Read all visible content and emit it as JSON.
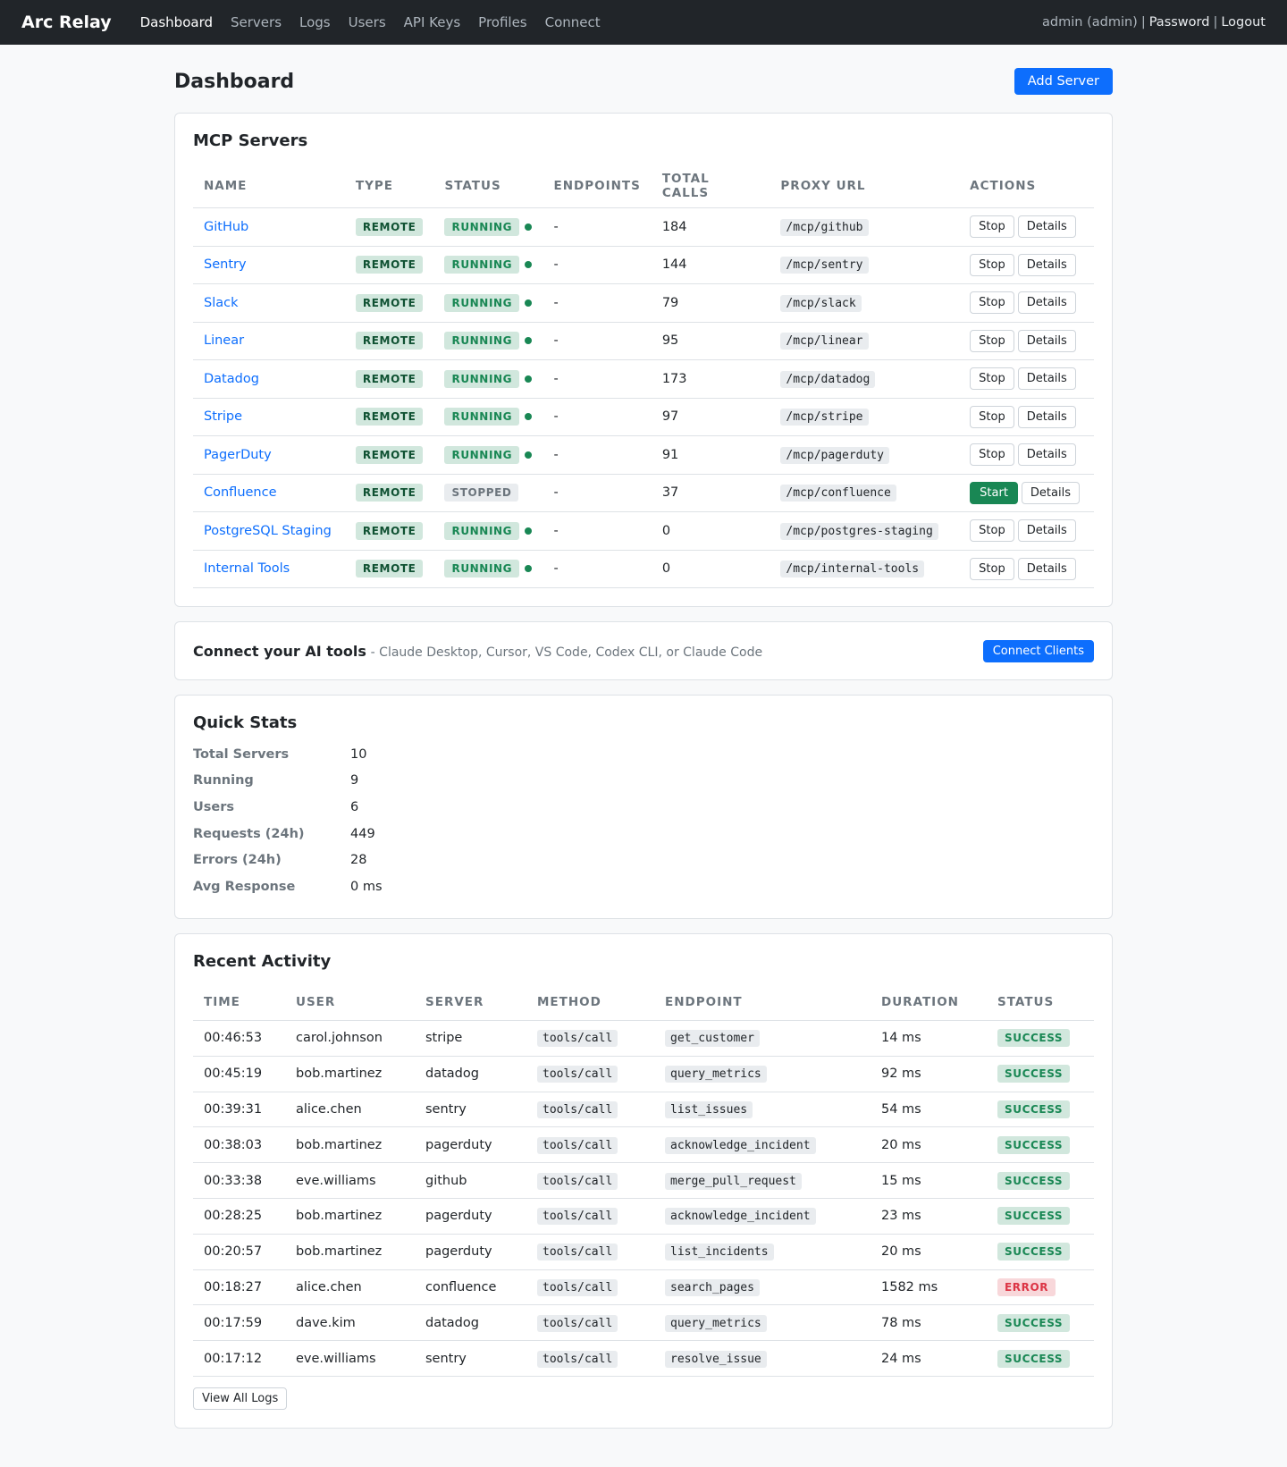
{
  "nav": {
    "brand": "Arc Relay",
    "links": [
      "Dashboard",
      "Servers",
      "Logs",
      "Users",
      "API Keys",
      "Profiles",
      "Connect"
    ],
    "user": "admin (admin)",
    "password": "Password",
    "logout": "Logout",
    "sep": "|"
  },
  "page": {
    "title": "Dashboard",
    "add_server": "Add Server"
  },
  "servers": {
    "title": "MCP Servers",
    "headers": [
      "Name",
      "Type",
      "Status",
      "Endpoints",
      "Total Calls",
      "Proxy URL",
      "Actions"
    ],
    "rows": [
      {
        "name": "GitHub",
        "type": "REMOTE",
        "status": "RUNNING",
        "endpoints": "-",
        "calls": "184",
        "url": "/mcp/github",
        "action": "Stop",
        "details": "Details"
      },
      {
        "name": "Sentry",
        "type": "REMOTE",
        "status": "RUNNING",
        "endpoints": "-",
        "calls": "144",
        "url": "/mcp/sentry",
        "action": "Stop",
        "details": "Details"
      },
      {
        "name": "Slack",
        "type": "REMOTE",
        "status": "RUNNING",
        "endpoints": "-",
        "calls": "79",
        "url": "/mcp/slack",
        "action": "Stop",
        "details": "Details"
      },
      {
        "name": "Linear",
        "type": "REMOTE",
        "status": "RUNNING",
        "endpoints": "-",
        "calls": "95",
        "url": "/mcp/linear",
        "action": "Stop",
        "details": "Details"
      },
      {
        "name": "Datadog",
        "type": "REMOTE",
        "status": "RUNNING",
        "endpoints": "-",
        "calls": "173",
        "url": "/mcp/datadog",
        "action": "Stop",
        "details": "Details"
      },
      {
        "name": "Stripe",
        "type": "REMOTE",
        "status": "RUNNING",
        "endpoints": "-",
        "calls": "97",
        "url": "/mcp/stripe",
        "action": "Stop",
        "details": "Details"
      },
      {
        "name": "PagerDuty",
        "type": "REMOTE",
        "status": "RUNNING",
        "endpoints": "-",
        "calls": "91",
        "url": "/mcp/pagerduty",
        "action": "Stop",
        "details": "Details"
      },
      {
        "name": "Confluence",
        "type": "REMOTE",
        "status": "STOPPED",
        "endpoints": "-",
        "calls": "37",
        "url": "/mcp/confluence",
        "action": "Start",
        "details": "Details"
      },
      {
        "name": "PostgreSQL Staging",
        "type": "REMOTE",
        "status": "RUNNING",
        "endpoints": "-",
        "calls": "0",
        "url": "/mcp/postgres-staging",
        "action": "Stop",
        "details": "Details"
      },
      {
        "name": "Internal Tools",
        "type": "REMOTE",
        "status": "RUNNING",
        "endpoints": "-",
        "calls": "0",
        "url": "/mcp/internal-tools",
        "action": "Stop",
        "details": "Details"
      }
    ]
  },
  "connect": {
    "title": "Connect your AI tools",
    "subtitle": "- Claude Desktop, Cursor, VS Code, Codex CLI, or Claude Code",
    "button": "Connect Clients"
  },
  "stats": {
    "title": "Quick Stats",
    "items": [
      {
        "label": "Total Servers",
        "value": "10"
      },
      {
        "label": "Running",
        "value": "9"
      },
      {
        "label": "Users",
        "value": "6"
      },
      {
        "label": "Requests (24h)",
        "value": "449"
      },
      {
        "label": "Errors (24h)",
        "value": "28"
      },
      {
        "label": "Avg Response",
        "value": "0 ms"
      }
    ]
  },
  "activity": {
    "title": "Recent Activity",
    "headers": [
      "Time",
      "User",
      "Server",
      "Method",
      "Endpoint",
      "Duration",
      "Status"
    ],
    "rows": [
      {
        "time": "00:46:53",
        "user": "carol.johnson",
        "server": "stripe",
        "method": "tools/call",
        "endpoint": "get_customer",
        "duration": "14 ms",
        "status": "SUCCESS"
      },
      {
        "time": "00:45:19",
        "user": "bob.martinez",
        "server": "datadog",
        "method": "tools/call",
        "endpoint": "query_metrics",
        "duration": "92 ms",
        "status": "SUCCESS"
      },
      {
        "time": "00:39:31",
        "user": "alice.chen",
        "server": "sentry",
        "method": "tools/call",
        "endpoint": "list_issues",
        "duration": "54 ms",
        "status": "SUCCESS"
      },
      {
        "time": "00:38:03",
        "user": "bob.martinez",
        "server": "pagerduty",
        "method": "tools/call",
        "endpoint": "acknowledge_incident",
        "duration": "20 ms",
        "status": "SUCCESS"
      },
      {
        "time": "00:33:38",
        "user": "eve.williams",
        "server": "github",
        "method": "tools/call",
        "endpoint": "merge_pull_request",
        "duration": "15 ms",
        "status": "SUCCESS"
      },
      {
        "time": "00:28:25",
        "user": "bob.martinez",
        "server": "pagerduty",
        "method": "tools/call",
        "endpoint": "acknowledge_incident",
        "duration": "23 ms",
        "status": "SUCCESS"
      },
      {
        "time": "00:20:57",
        "user": "bob.martinez",
        "server": "pagerduty",
        "method": "tools/call",
        "endpoint": "list_incidents",
        "duration": "20 ms",
        "status": "SUCCESS"
      },
      {
        "time": "00:18:27",
        "user": "alice.chen",
        "server": "confluence",
        "method": "tools/call",
        "endpoint": "search_pages",
        "duration": "1582 ms",
        "status": "ERROR"
      },
      {
        "time": "00:17:59",
        "user": "dave.kim",
        "server": "datadog",
        "method": "tools/call",
        "endpoint": "query_metrics",
        "duration": "78 ms",
        "status": "SUCCESS"
      },
      {
        "time": "00:17:12",
        "user": "eve.williams",
        "server": "sentry",
        "method": "tools/call",
        "endpoint": "resolve_issue",
        "duration": "24 ms",
        "status": "SUCCESS"
      }
    ],
    "view_all": "View All Logs"
  }
}
